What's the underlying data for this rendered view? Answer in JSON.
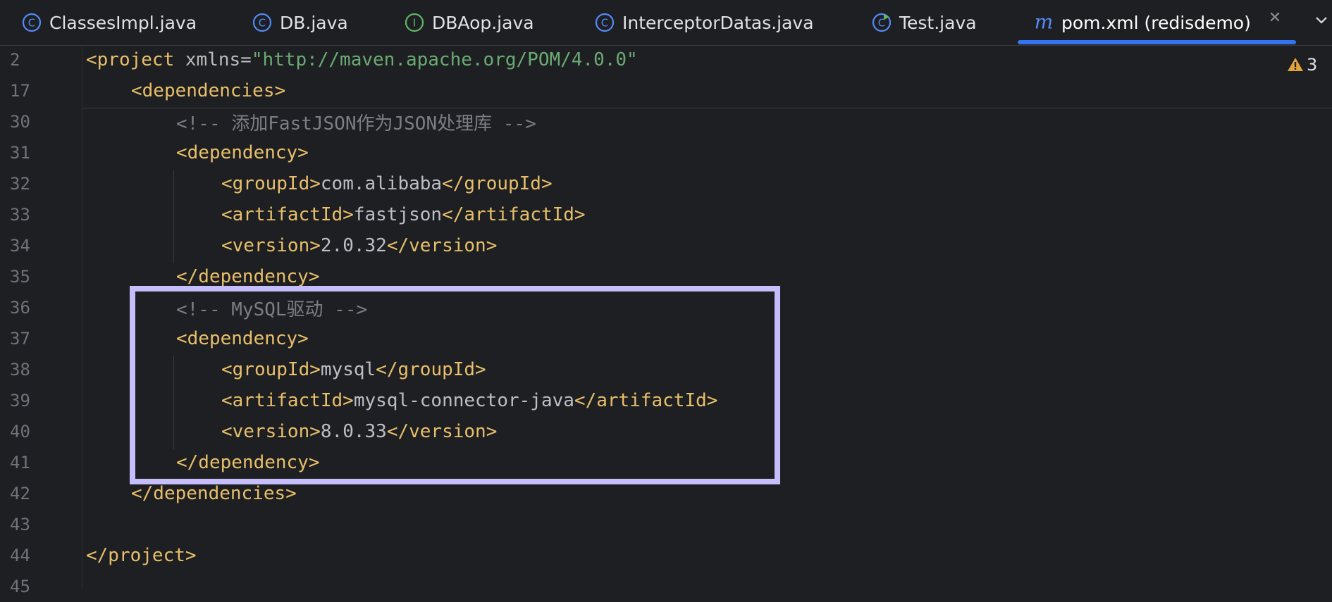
{
  "tabs": [
    {
      "label": "ClassesImpl.java",
      "icon": "class-icon"
    },
    {
      "label": "DB.java",
      "icon": "class-icon"
    },
    {
      "label": "DBAop.java",
      "icon": "interface-icon"
    },
    {
      "label": "InterceptorDatas.java",
      "icon": "class-icon"
    },
    {
      "label": "Test.java",
      "icon": "runnable-class-icon"
    },
    {
      "label": "pom.xml (redisdemo)",
      "icon": "maven-icon",
      "active": true
    }
  ],
  "warnings": {
    "count": "3"
  },
  "lines": [
    {
      "no": "2",
      "parts": [
        [
          "tag",
          "<project "
        ],
        [
          "attr",
          "xmlns"
        ],
        [
          "txt",
          "="
        ],
        [
          "str",
          "\"http://maven.apache.org/POM/4.0.0\""
        ]
      ]
    },
    {
      "no": "17",
      "parts": [
        [
          "tag",
          "<dependencies>"
        ]
      ]
    },
    {
      "no": "30",
      "parts": [
        [
          "cmt",
          "<!-- 添加FastJSON作为JSON处理库 -->"
        ]
      ]
    },
    {
      "no": "31",
      "parts": [
        [
          "tag",
          "<dependency>"
        ]
      ]
    },
    {
      "no": "32",
      "parts": [
        [
          "tag",
          "<groupId>"
        ],
        [
          "txt",
          "com.alibaba"
        ],
        [
          "tag",
          "</groupId>"
        ]
      ]
    },
    {
      "no": "33",
      "parts": [
        [
          "tag",
          "<artifactId>"
        ],
        [
          "txt",
          "fastjson"
        ],
        [
          "tag",
          "</artifactId>"
        ]
      ]
    },
    {
      "no": "34",
      "parts": [
        [
          "tag",
          "<version>"
        ],
        [
          "txt",
          "2.0.32"
        ],
        [
          "tag",
          "</version>"
        ]
      ]
    },
    {
      "no": "35",
      "parts": [
        [
          "tag",
          "</dependency>"
        ]
      ]
    },
    {
      "no": "36",
      "parts": [
        [
          "cmt",
          "<!-- MySQL驱动 -->"
        ]
      ]
    },
    {
      "no": "37",
      "parts": [
        [
          "tag",
          "<dependency>"
        ]
      ]
    },
    {
      "no": "38",
      "parts": [
        [
          "tag",
          "<groupId>"
        ],
        [
          "txt",
          "mysql"
        ],
        [
          "tag",
          "</groupId>"
        ]
      ]
    },
    {
      "no": "39",
      "parts": [
        [
          "tag",
          "<artifactId>"
        ],
        [
          "txt",
          "mysql-connector-java"
        ],
        [
          "tag",
          "</artifactId>"
        ]
      ]
    },
    {
      "no": "40",
      "parts": [
        [
          "tag",
          "<version>"
        ],
        [
          "txt",
          "8.0.33"
        ],
        [
          "tag",
          "</version>"
        ]
      ]
    },
    {
      "no": "41",
      "parts": [
        [
          "tag",
          "</dependency>"
        ]
      ]
    },
    {
      "no": "42",
      "parts": [
        [
          "tag",
          "</dependencies>"
        ]
      ]
    },
    {
      "no": "43",
      "parts": []
    },
    {
      "no": "44",
      "parts": [
        [
          "tag",
          "</project>"
        ]
      ]
    },
    {
      "no": "45",
      "parts": []
    }
  ],
  "colors": {
    "accent": "#3574f0",
    "highlight": "#c5befa",
    "warning": "#e3a33c"
  }
}
